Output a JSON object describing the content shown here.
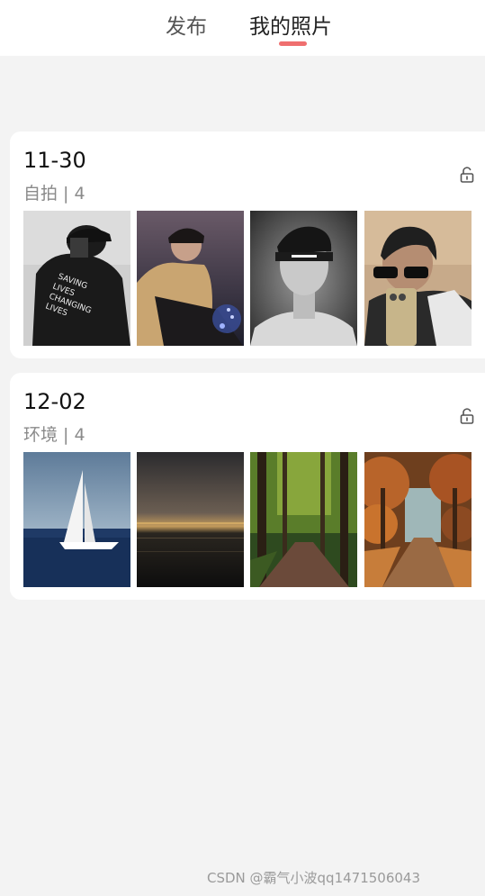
{
  "header": {
    "tabs": [
      {
        "label": "发布",
        "active": false
      },
      {
        "label": "我的照片",
        "active": true
      }
    ],
    "accent_color": "#ef6f6f"
  },
  "albums": [
    {
      "date": "11-30",
      "subtitle": "自拍 | 4",
      "lock_icon": "unlock-icon",
      "photos": [
        "man-black-cap-shirt-photo",
        "man-sitting-beanie-photo",
        "man-headband-bw-photo",
        "man-sunglasses-mirror-selfie-photo"
      ]
    },
    {
      "date": "12-02",
      "subtitle": "环境 | 4",
      "lock_icon": "unlock-icon",
      "photos": [
        "sailboat-sea-photo",
        "sunset-sea-photo",
        "forest-path-photo",
        "autumn-road-photo"
      ]
    }
  ],
  "watermark": "CSDN @霸气小波qq1471506043"
}
